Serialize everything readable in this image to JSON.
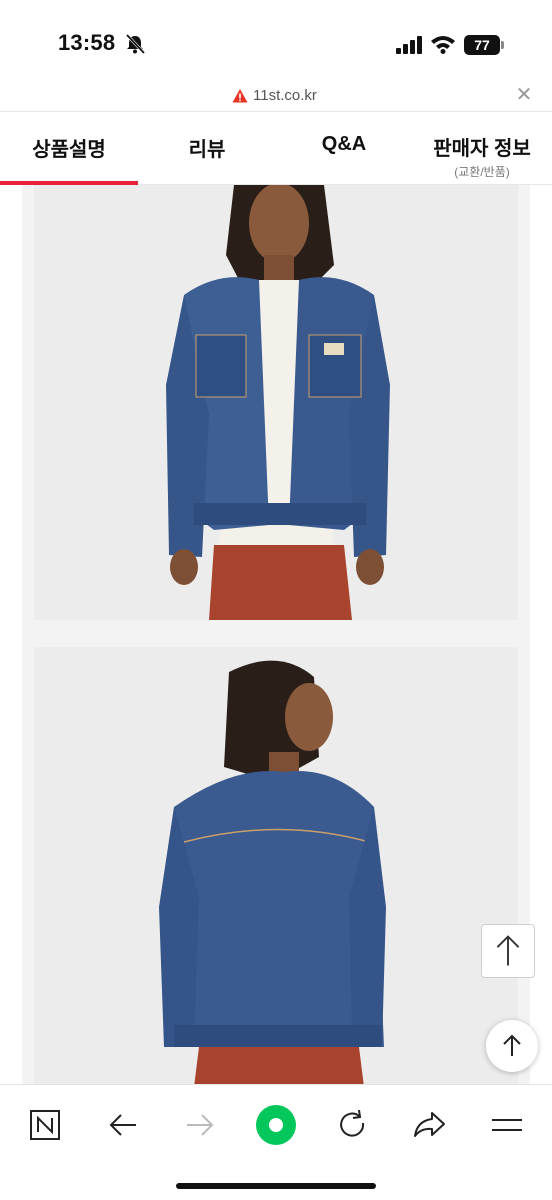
{
  "status_bar": {
    "time": "13:58",
    "battery_level": "77",
    "icons": [
      "bell-slash-icon",
      "signal-icon",
      "wifi-icon",
      "battery-icon"
    ]
  },
  "url_bar": {
    "domain": "11st.co.kr",
    "warning_icon": "warning-triangle-icon",
    "close_icon": "close-icon",
    "warning_color": "#e8352a"
  },
  "tabs": [
    {
      "label": "상품설명",
      "sub": "",
      "active": true
    },
    {
      "label": "리뷰",
      "sub": ""
    },
    {
      "label": "Q&A",
      "sub": ""
    },
    {
      "label": "판매자 정보",
      "sub": "(교환/반품)"
    }
  ],
  "accent_color": "#e8203a",
  "product_images": [
    {
      "name": "denim-jacket-front-photo"
    },
    {
      "name": "denim-jacket-back-photo"
    }
  ],
  "floating": {
    "scroll_top_square_icon": "arrow-up-icon",
    "scroll_top_circle_icon": "arrow-up-icon"
  },
  "toolbar": {
    "items": [
      {
        "icon": "naver-n-icon"
      },
      {
        "icon": "back-arrow-icon"
      },
      {
        "icon": "forward-arrow-icon",
        "disabled": true
      },
      {
        "icon": "green-dot-icon"
      },
      {
        "icon": "reload-icon"
      },
      {
        "icon": "share-icon"
      },
      {
        "icon": "menu-icon"
      }
    ],
    "green_color": "#03c75a"
  }
}
